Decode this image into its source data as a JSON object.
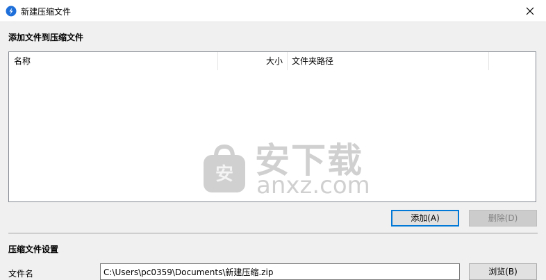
{
  "window": {
    "title": "新建压缩文件",
    "icon": "app-icon",
    "close_icon": "×"
  },
  "add_section": {
    "title": "添加文件到压缩文件",
    "columns": {
      "name": "名称",
      "size": "大小",
      "path": "文件夹路径"
    },
    "rows": []
  },
  "watermark": {
    "name": "安下载",
    "domain": "anxz.com",
    "logo_char": "安"
  },
  "buttons": {
    "add_label": "添加(A)",
    "delete_label": "删除(D)",
    "browse_label": "浏览(B)"
  },
  "settings_section": {
    "title": "压缩文件设置",
    "filename_label": "文件名",
    "filename_value": "C:\\Users\\pc0359\\Documents\\新建压缩.zip"
  },
  "colors": {
    "accent": "#0078d7",
    "app_icon": "#1e6fd9"
  }
}
